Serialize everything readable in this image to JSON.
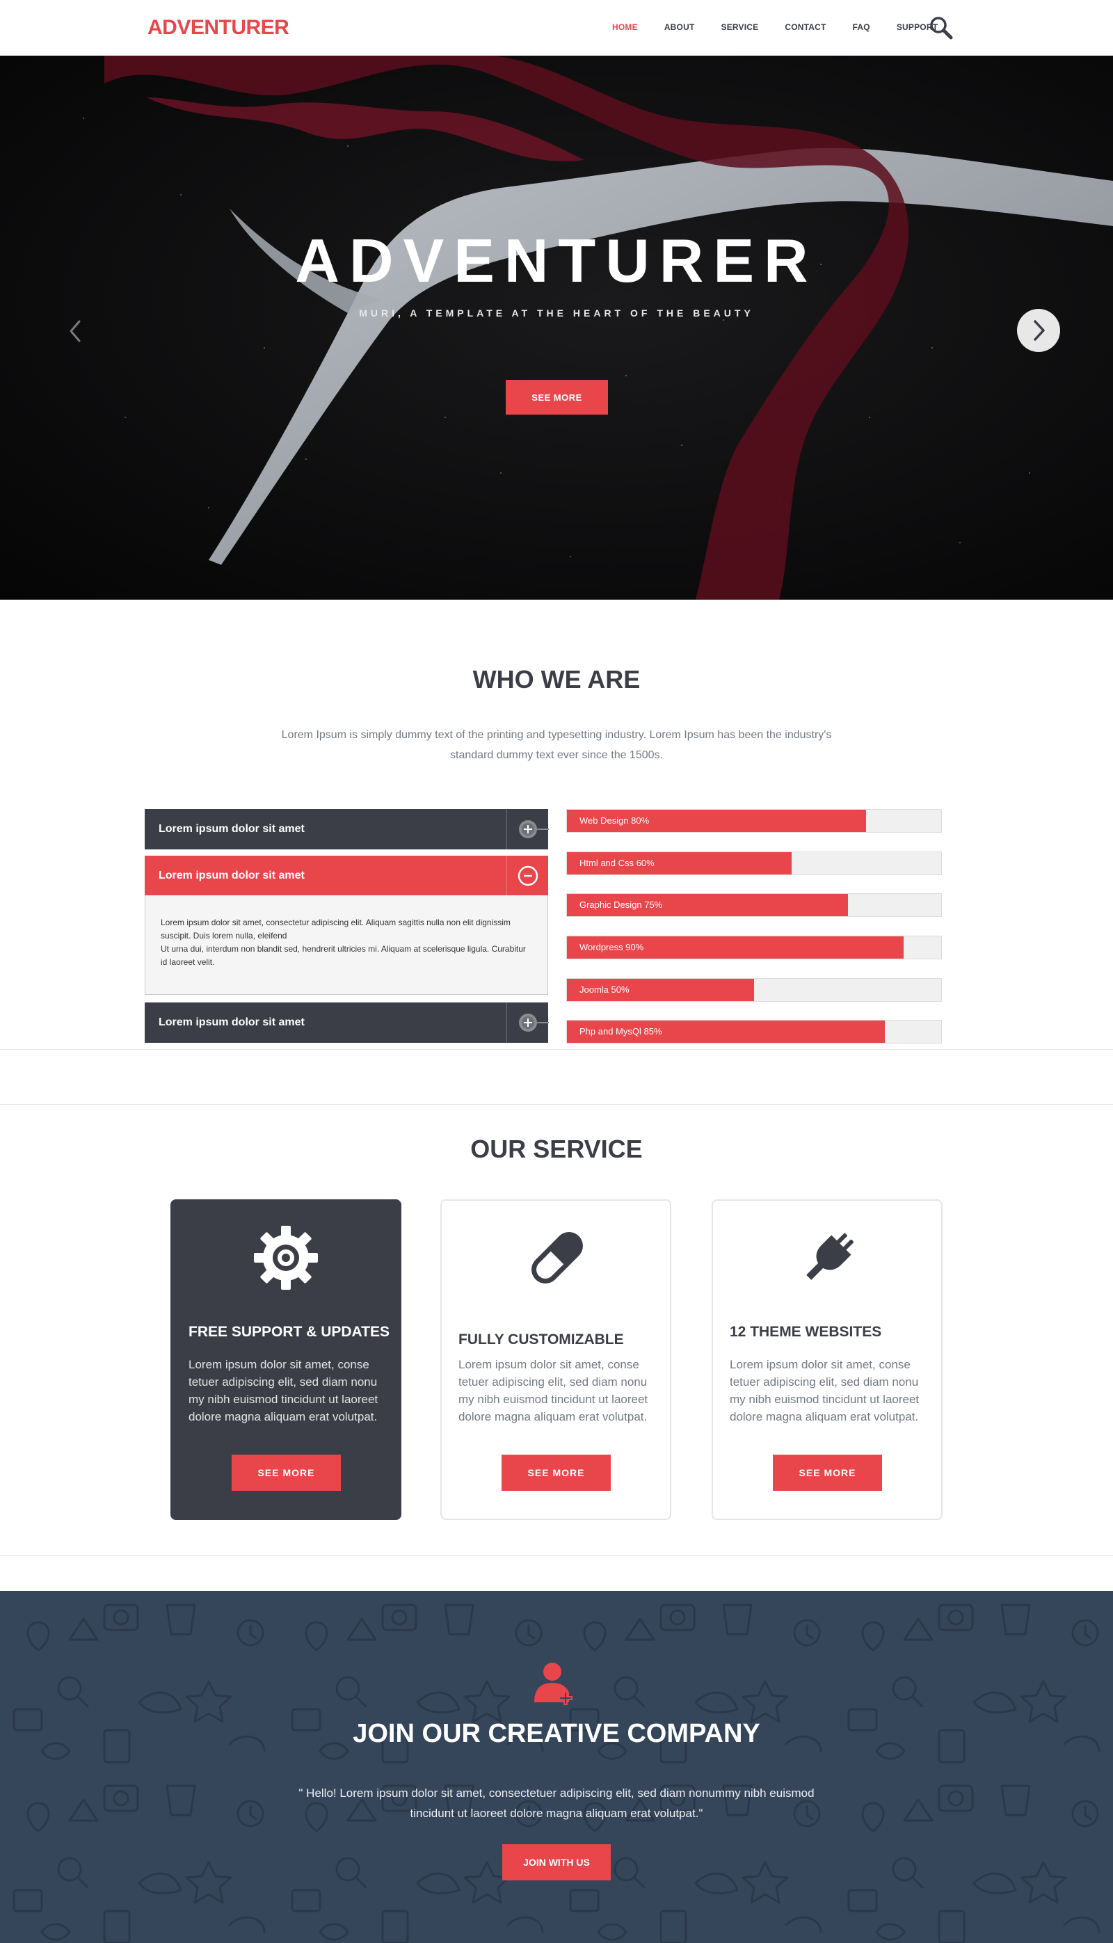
{
  "header": {
    "logo": "ADVENTURER",
    "nav": [
      "HOME",
      "ABOUT",
      "SERVICE",
      "CONTACT",
      "FAQ",
      "SUPPORT"
    ],
    "active_nav": "HOME"
  },
  "hero": {
    "title": "ADVENTURER",
    "subtitle": "MURI, A TEMPLATE AT THE HEART OF THE BEAUTY",
    "button": "SEE MORE"
  },
  "who": {
    "title": "WHO WE ARE",
    "intro": "Lorem Ipsum is simply dummy text of the printing and typesetting industry. Lorem Ipsum has been the industry's standard dummy text ever since the 1500s.",
    "accordion": [
      {
        "label": "Lorem ipsum dolor sit amet",
        "expanded": false
      },
      {
        "label": "Lorem ipsum dolor sit amet",
        "expanded": true
      },
      {
        "label": "Lorem ipsum dolor sit amet",
        "expanded": false
      }
    ],
    "accordion_body": [
      "Lorem ipsum dolor sit amet, consectetur adipiscing elit. Aliquam sagittis nulla non elit dignissim suscipit. Duis lorem nulla, eleifend",
      "Ut urna dui, interdum non blandit sed, hendrerit ultricies mi. Aliquam at scelerisque ligula. Curabitur id laoreet velit."
    ],
    "skills": [
      {
        "label": "Web Design 80%",
        "percent": 80
      },
      {
        "label": "Html and Css 60%",
        "percent": 60
      },
      {
        "label": "Graphic Design 75%",
        "percent": 75
      },
      {
        "label": "Wordpress 90%",
        "percent": 90
      },
      {
        "label": "Joomla 50%",
        "percent": 50
      },
      {
        "label": "Php and MysQl 85%",
        "percent": 85
      }
    ]
  },
  "service": {
    "title": "OUR SERVICE",
    "cards": [
      {
        "icon": "gear-icon",
        "title": "FREE SUPPORT & UPDATES",
        "text": "Lorem ipsum dolor sit amet, conse tetuer adipiscing elit, sed diam nonu my nibh euismod tincidunt ut laoreet dolore magna aliquam erat volutpat.",
        "button": "SEE  MORE"
      },
      {
        "icon": "pill-icon",
        "title": "FULLY CUSTOMIZABLE",
        "text": "Lorem ipsum dolor sit amet, conse tetuer adipiscing elit, sed diam nonu my nibh euismod tincidunt ut laoreet dolore magna aliquam erat volutpat.",
        "button": "SEE  MORE"
      },
      {
        "icon": "plug-icon",
        "title": "12 THEME WEBSITES",
        "text": "Lorem ipsum dolor sit amet, conse tetuer adipiscing elit, sed diam nonu my nibh euismod tincidunt ut laoreet dolore magna aliquam erat volutpat.",
        "button": "SEE  MORE"
      }
    ]
  },
  "join": {
    "title": "JOIN OUR CREATIVE COMPANY",
    "text": "\" Hello! Lorem ipsum dolor sit amet, consectetuer adipiscing elit, sed diam nonummy nibh euismod tincidunt ut laoreet dolore magna aliquam erat volutpat.\"",
    "button": "JOIN WITH US",
    "icon": "add-user-icon"
  },
  "colors": {
    "accent": "#e8464b",
    "dark": "#3b3e47",
    "navy": "#35455a",
    "muted_text": "#737983"
  }
}
